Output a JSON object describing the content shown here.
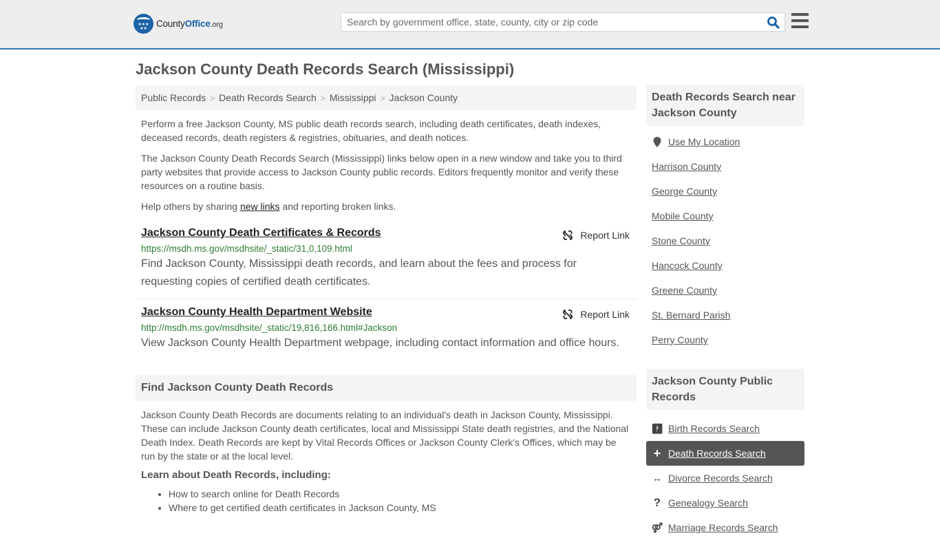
{
  "header": {
    "logo": {
      "part1": "County",
      "part2": "Office",
      "part3": ".org"
    },
    "search_placeholder": "Search by government office, state, county, city or zip code",
    "accent_color": "#1b62a8"
  },
  "page_title": "Jackson County Death Records Search (Mississippi)",
  "breadcrumb": [
    "Public Records",
    "Death Records Search",
    "Mississippi",
    "Jackson County"
  ],
  "intro": {
    "p1": "Perform a free Jackson County, MS public death records search, including death certificates, death indexes, deceased records, death registers & registries, obituaries, and death notices.",
    "p2": "The Jackson County Death Records Search (Mississippi) links below open in a new window and take you to third party websites that provide access to Jackson County public records. Editors frequently monitor and verify these resources on a routine basis.",
    "p3_before": "Help others by sharing ",
    "p3_link": "new links",
    "p3_after": " and reporting broken links."
  },
  "results": [
    {
      "title": "Jackson County Death Certificates & Records",
      "url": "https://msdh.ms.gov/msdhsite/_static/31,0,109.html",
      "description": "Find Jackson County, Mississippi death records, and learn about the fees and process for requesting copies of certified death certificates.",
      "report_label": "Report Link"
    },
    {
      "title": "Jackson County Health Department Website",
      "url": "http://msdh.ms.gov/msdhsite/_static/19,816,166.html#Jackson",
      "description": "View Jackson County Health Department webpage, including contact information and office hours.",
      "report_label": "Report Link"
    }
  ],
  "find_section": {
    "heading": "Find Jackson County Death Records",
    "body": "Jackson County Death Records are documents relating to an individual's death in Jackson County, Mississippi. These can include Jackson County death certificates, local and Mississippi State death registries, and the National Death Index. Death Records are kept by Vital Records Offices or Jackson County Clerk's Offices, which may be run by the state or at the local level.",
    "learn_heading": "Learn about Death Records, including:",
    "learn_items": [
      "How to search online for Death Records",
      "Where to get certified death certificates in Jackson County, MS"
    ]
  },
  "sidebar_nearby": {
    "heading": "Death Records Search near Jackson County",
    "use_location": "Use My Location",
    "items": [
      "Harrison County",
      "George County",
      "Mobile County",
      "Stone County",
      "Hancock County",
      "Greene County",
      "St. Bernard Parish",
      "Perry County"
    ]
  },
  "sidebar_public": {
    "heading": "Jackson County Public Records",
    "items": [
      {
        "label": "Birth Records Search",
        "icon": "child-icon",
        "active": false
      },
      {
        "label": "Death Records Search",
        "icon": "plus-icon",
        "active": true
      },
      {
        "label": "Divorce Records Search",
        "icon": "arrows-horizontal-icon",
        "active": false
      },
      {
        "label": "Genealogy Search",
        "icon": "question-icon",
        "active": false
      },
      {
        "label": "Marriage Records Search",
        "icon": "marriage-icon",
        "active": false
      }
    ]
  }
}
